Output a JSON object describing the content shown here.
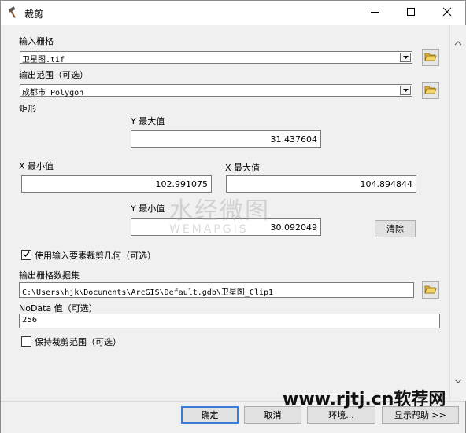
{
  "window": {
    "title": "裁剪"
  },
  "form": {
    "input_raster": {
      "label": "输入栅格",
      "value": "卫星图.tif"
    },
    "output_extent": {
      "label": "输出范围（可选）",
      "value": "成都市_Polygon"
    },
    "rectangle": {
      "label": "矩形",
      "y_max_label": "Y 最大值",
      "y_max": "31.437604",
      "x_min_label": "X 最小值",
      "x_min": "102.991075",
      "x_max_label": "X 最大值",
      "x_max": "104.894844",
      "y_min_label": "Y 最小值",
      "y_min": "30.092049",
      "clear_label": "清除"
    },
    "use_geometry": {
      "label": "使用输入要素裁剪几何（可选）",
      "checked": true
    },
    "output_raster": {
      "label": "输出栅格数据集",
      "value": "C:\\Users\\hjk\\Documents\\ArcGIS\\Default.gdb\\卫星图_Clip1"
    },
    "nodata": {
      "label": "NoData 值（可选）",
      "value": "256"
    },
    "keep_extent": {
      "label": "保持裁剪范围（可选）",
      "checked": false
    }
  },
  "footer": {
    "ok": "确定",
    "cancel": "取消",
    "environments": "环境...",
    "show_help": "显示帮助 >>"
  },
  "watermark": {
    "cn": "水经微图",
    "en": "WEMAPGIS"
  },
  "brand": "www.rjtj.cn软荐网"
}
